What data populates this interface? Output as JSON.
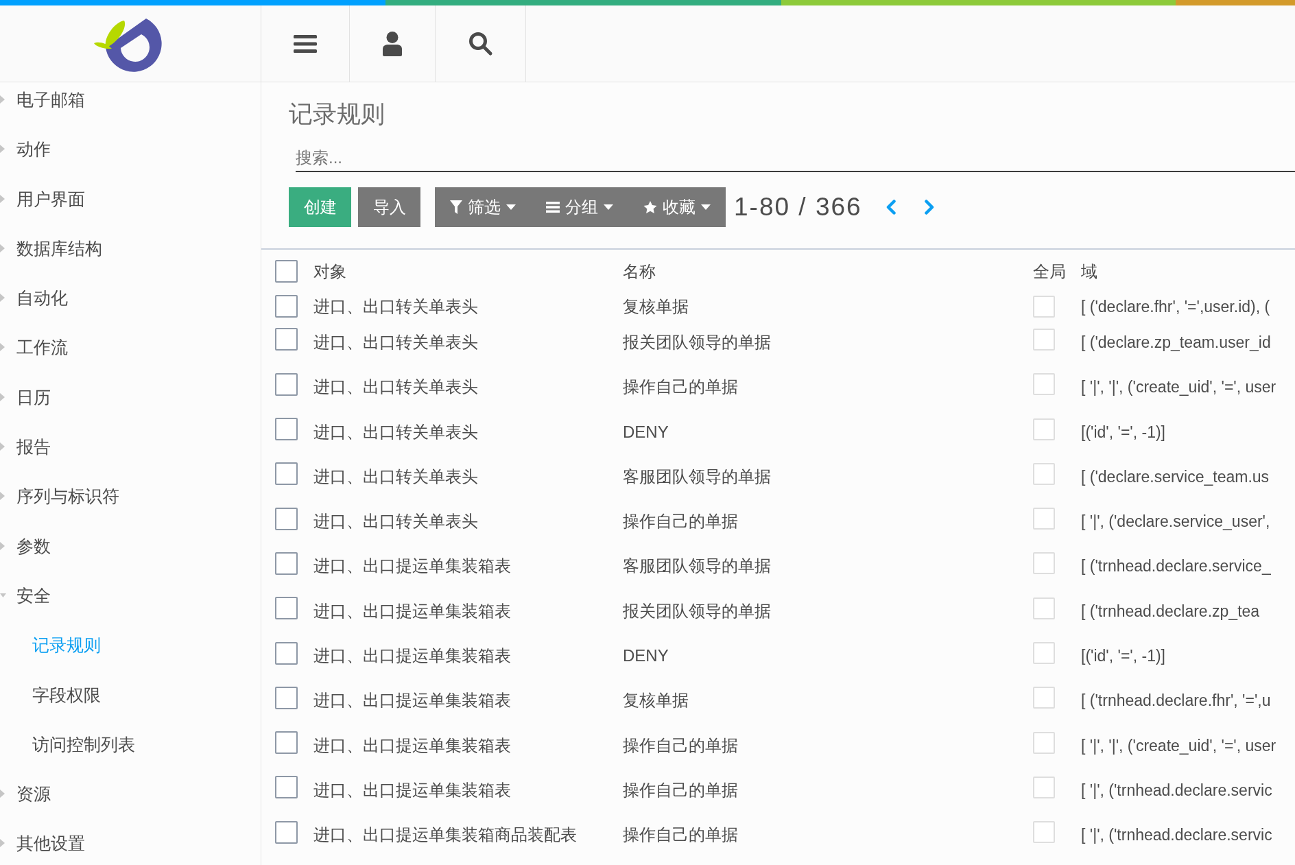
{
  "sidebar": {
    "items": [
      {
        "label": "电子邮箱",
        "expanded": false,
        "selected": false
      },
      {
        "label": "动作",
        "expanded": false,
        "selected": false
      },
      {
        "label": "用户界面",
        "expanded": false,
        "selected": false
      },
      {
        "label": "数据库结构",
        "expanded": false,
        "selected": false
      },
      {
        "label": "自动化",
        "expanded": false,
        "selected": false
      },
      {
        "label": "工作流",
        "expanded": false,
        "selected": false
      },
      {
        "label": "日历",
        "expanded": false,
        "selected": false
      },
      {
        "label": "报告",
        "expanded": false,
        "selected": false
      },
      {
        "label": "序列与标识符",
        "expanded": false,
        "selected": false
      },
      {
        "label": "参数",
        "expanded": false,
        "selected": false
      },
      {
        "label": "安全",
        "expanded": true,
        "selected": false,
        "children": [
          {
            "label": "记录规则",
            "selected": true
          },
          {
            "label": "字段权限",
            "selected": false
          },
          {
            "label": "访问控制列表",
            "selected": false
          }
        ]
      },
      {
        "label": "资源",
        "expanded": false,
        "selected": false
      },
      {
        "label": "其他设置",
        "expanded": false,
        "selected": false
      }
    ]
  },
  "page": {
    "title": "记录规则",
    "search": {
      "placeholder": "搜索..."
    }
  },
  "toolbar": {
    "buttons": [
      {
        "label": "创建",
        "kind": "primary"
      },
      {
        "label": "导入",
        "kind": "secondary"
      }
    ],
    "search_options": [
      {
        "label": "筛选",
        "kind": "filter"
      },
      {
        "label": "分组",
        "kind": "group"
      },
      {
        "label": "收藏",
        "kind": "favorites"
      }
    ],
    "pager": "1-80 / 366"
  },
  "table": {
    "select_all": {
      "checked": false
    },
    "columns": [
      "对象",
      "名称",
      "全局",
      "域"
    ],
    "rows": [
      {
        "selected": false,
        "object": "进口、出口转关单表头",
        "name": "复核单据",
        "global": false,
        "domain": "[ ('declare.fhr', '=',user.id), ("
      },
      {
        "selected": false,
        "object": "进口、出口转关单表头",
        "name": "报关团队领导的单据",
        "global": false,
        "domain": "[ ('declare.zp_team.user_id"
      },
      {
        "selected": false,
        "object": "进口、出口转关单表头",
        "name": "操作自己的单据",
        "global": false,
        "domain": "[ '|', '|', ('create_uid', '=', user"
      },
      {
        "selected": false,
        "object": "进口、出口转关单表头",
        "name": "DENY",
        "global": false,
        "domain": "[('id', '=', -1)]"
      },
      {
        "selected": false,
        "object": "进口、出口转关单表头",
        "name": "客服团队领导的单据",
        "global": false,
        "domain": "[ ('declare.service_team.us"
      },
      {
        "selected": false,
        "object": "进口、出口转关单表头",
        "name": "操作自己的单据",
        "global": false,
        "domain": "[ '|', ('declare.service_user',"
      },
      {
        "selected": false,
        "object": "进口、出口提运单集装箱表",
        "name": "客服团队领导的单据",
        "global": false,
        "domain": "[ ('trnhead.declare.service_"
      },
      {
        "selected": false,
        "object": "进口、出口提运单集装箱表",
        "name": "报关团队领导的单据",
        "global": false,
        "domain": "[ ('trnhead.declare.zp_tea"
      },
      {
        "selected": false,
        "object": "进口、出口提运单集装箱表",
        "name": "DENY",
        "global": false,
        "domain": "[('id', '=', -1)]"
      },
      {
        "selected": false,
        "object": "进口、出口提运单集装箱表",
        "name": "复核单据",
        "global": false,
        "domain": "[ ('trnhead.declare.fhr', '=',u"
      },
      {
        "selected": false,
        "object": "进口、出口提运单集装箱表",
        "name": "操作自己的单据",
        "global": false,
        "domain": "[ '|', '|', ('create_uid', '=', user"
      },
      {
        "selected": false,
        "object": "进口、出口提运单集装箱表",
        "name": "操作自己的单据",
        "global": false,
        "domain": "[ '|', ('trnhead.declare.servic"
      },
      {
        "selected": false,
        "object": "进口、出口提运单集装箱商品装配表",
        "name": "操作自己的单据",
        "global": false,
        "domain": "[ '|', ('trnhead.declare.servic"
      }
    ]
  }
}
